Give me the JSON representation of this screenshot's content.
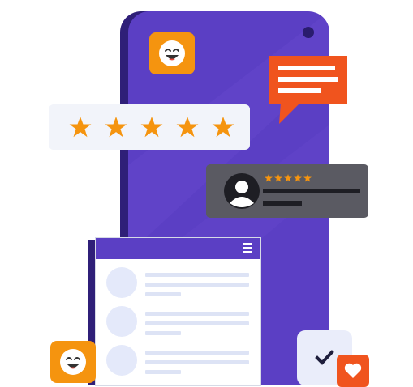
{
  "illustration": {
    "rating": {
      "stars": 5,
      "max": 5
    },
    "review": {
      "stars": 5,
      "max": 5
    },
    "list_window": {
      "rows": 3
    }
  },
  "colors": {
    "phone": "#5b3fc4",
    "phone_shadow": "#2f1f78",
    "accent_orange": "#f5940f",
    "bubble_orange": "#f0541e",
    "card_light": "#f2f4fa",
    "review_card": "#5a5a62",
    "star": "#f5940f"
  },
  "icons": [
    "smiley-icon",
    "chat-bubble-icon",
    "star-icon",
    "user-avatar-icon",
    "hamburger-menu-icon",
    "checkmark-icon",
    "heart-icon"
  ]
}
